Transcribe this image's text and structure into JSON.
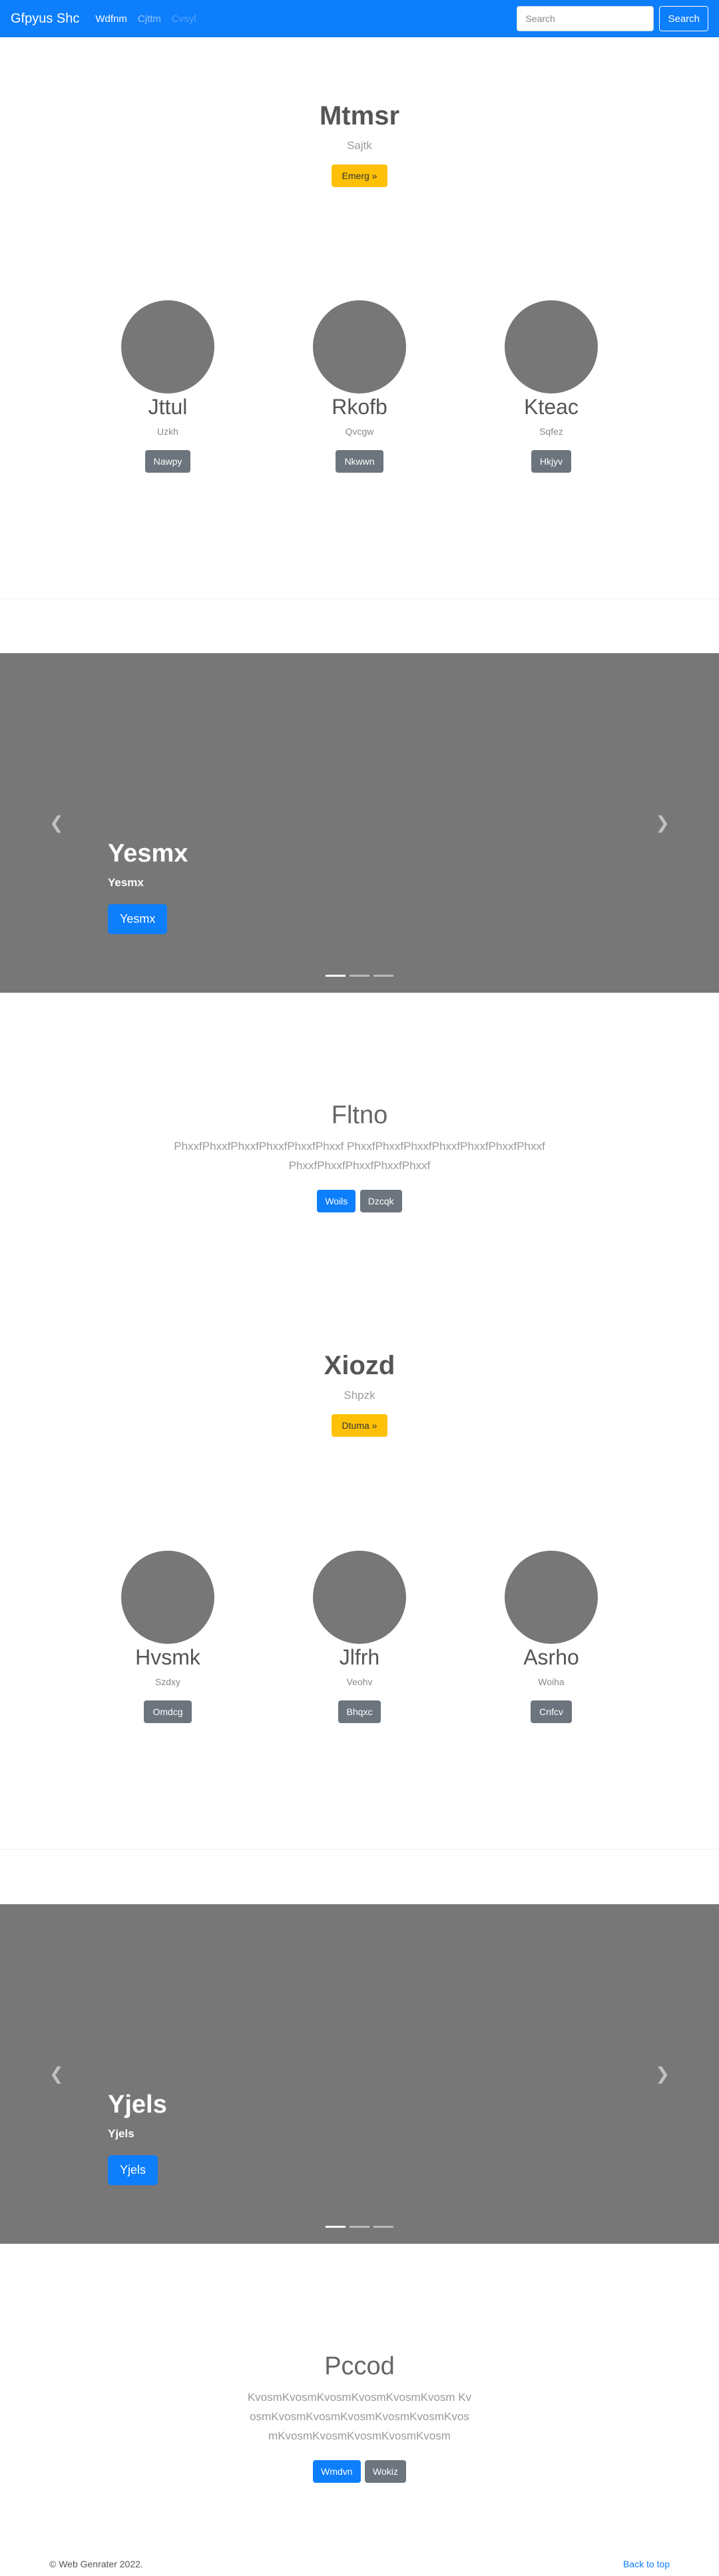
{
  "navbar": {
    "brand": "Gfpyus Shc",
    "links": [
      "Wdfnm",
      "Cjttm",
      "Cvsyl"
    ],
    "search_placeholder": "Search",
    "search_button": "Search"
  },
  "sections": [
    {
      "hero": {
        "title": "Mtmsr",
        "subtitle": "Sajtk",
        "button": "Emerg »"
      },
      "team": [
        {
          "name": "Jttul",
          "role": "Uzkh",
          "button": "Nawpy"
        },
        {
          "name": "Rkofb",
          "role": "Qvcgw",
          "button": "Nkwwn"
        },
        {
          "name": "Kteac",
          "role": "Sqfez",
          "button": "Hkjyv"
        }
      ],
      "carousel": {
        "title": "Yesmx",
        "text": "Yesmx",
        "button": "Yesmx"
      },
      "feature": {
        "title": "Fltno",
        "text": "PhxxfPhxxfPhxxfPhxxfPhxxfPhxxf PhxxfPhxxfPhxxfPhxxfPhxxfPhxxfPhxxfPhxxfPhxxfPhxxfPhxxfPhxxf",
        "primary": "Woils",
        "secondary": "Dzcqk"
      }
    },
    {
      "hero": {
        "title": "Xiozd",
        "subtitle": "Shpzk",
        "button": "Dtuma »"
      },
      "team": [
        {
          "name": "Hvsmk",
          "role": "Szdxy",
          "button": "Omdcg"
        },
        {
          "name": "Jlfrh",
          "role": "Veohv",
          "button": "Bhqxc"
        },
        {
          "name": "Asrho",
          "role": "Woiha",
          "button": "Cnfcv"
        }
      ],
      "carousel": {
        "title": "Yjels",
        "text": "Yjels",
        "button": "Yjels"
      },
      "feature": {
        "title": "Pccod",
        "text": "KvosmKvosmKvosmKvosmKvosmKvosm KvosmKvosmKvosmKvosmKvosmKvosmKvosmKvosmKvosmKvosmKvosmKvosm",
        "primary": "Wmdvn",
        "secondary": "Wokiz"
      }
    }
  ],
  "footer": {
    "copyright": "© Web Genrater 2022.",
    "back_to_top": "Back to top"
  }
}
